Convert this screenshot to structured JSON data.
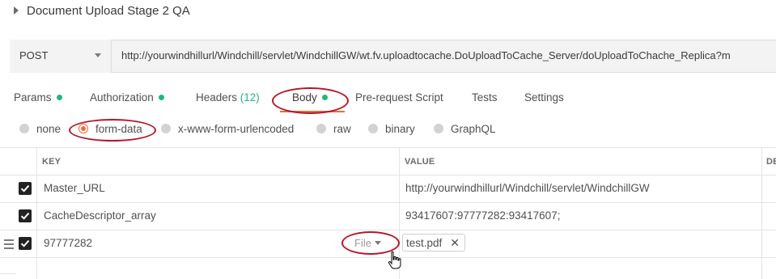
{
  "collection": {
    "title": "Document Upload Stage 2 QA"
  },
  "request": {
    "method": "POST",
    "url": "http://yourwindhillurl/Windchill/servlet/WindchillGW/wt.fv.uploadtocache.DoUploadToCache_Server/doUploadToChache_Replica?m"
  },
  "tabs": [
    {
      "label": "Params",
      "has_dot": true
    },
    {
      "label": "Authorization",
      "has_dot": true
    },
    {
      "label": "Headers",
      "count": "(12)"
    },
    {
      "label": "Body",
      "has_dot": true,
      "active": true
    },
    {
      "label": "Pre-request Script"
    },
    {
      "label": "Tests"
    },
    {
      "label": "Settings"
    }
  ],
  "body_types": [
    {
      "label": "none"
    },
    {
      "label": "form-data",
      "selected": true
    },
    {
      "label": "x-www-form-urlencoded"
    },
    {
      "label": "raw"
    },
    {
      "label": "binary"
    },
    {
      "label": "GraphQL"
    }
  ],
  "table": {
    "headers": {
      "key": "KEY",
      "value": "VALUE",
      "description": "DE"
    },
    "rows": [
      {
        "key": "Master_URL",
        "value": "http://yourwindhillurl/Windchill/servlet/WindchillGW",
        "checked": true
      },
      {
        "key": "CacheDescriptor_array",
        "value": "93417607:97777282:93417607;",
        "checked": true
      },
      {
        "key": "97777282",
        "type": "File",
        "value": "test.pdf",
        "checked": true
      }
    ]
  },
  "colors": {
    "accent": "#f26b3a",
    "indicator_green": "#26b47f",
    "annotation_red": "#b5172b"
  },
  "icons": [
    "chevron-right-icon",
    "chevron-down-icon",
    "checkbox-checked-icon",
    "drag-handle-icon",
    "close-icon",
    "hand-cursor-icon"
  ]
}
